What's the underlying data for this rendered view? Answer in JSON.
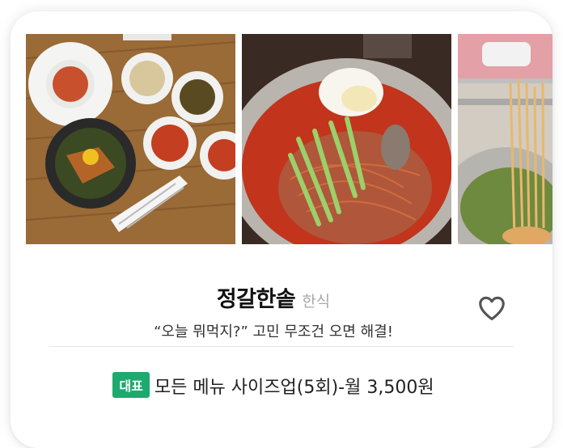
{
  "restaurant": {
    "name": "정갈한솥",
    "category": "한식",
    "tagline": "“오늘 뭐먹지?” 고민 무조건 오면 해결!"
  },
  "promo": {
    "badge": "대표",
    "text": "모든 메뉴 사이즈업(5회)-월 3,500원"
  },
  "photos": [
    "bibimbap-set-photo",
    "bibim-naengmyeon-photo",
    "noodles-photo"
  ],
  "colors": {
    "badge": "#1cab6e",
    "heart": "#555555"
  }
}
